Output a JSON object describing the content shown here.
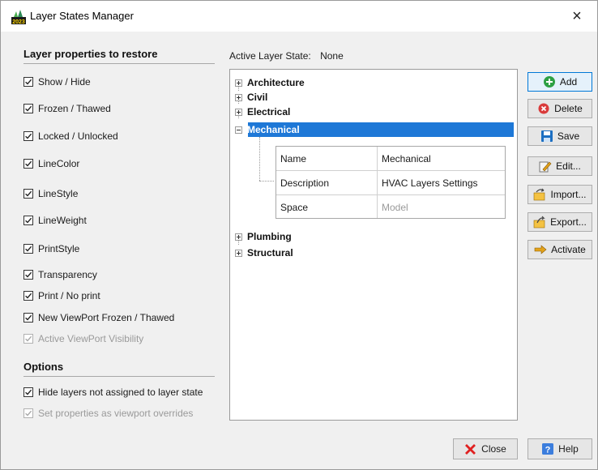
{
  "window": {
    "title": "Layer States Manager",
    "close_glyph": "×",
    "app_icon": "app-logo-icon"
  },
  "left": {
    "restore_title": "Layer properties to restore",
    "restore_items": [
      {
        "label": "Show / Hide",
        "checked": true,
        "enabled": true
      },
      {
        "label": "Frozen / Thawed",
        "checked": true,
        "enabled": true
      },
      {
        "label": "Locked / Unlocked",
        "checked": true,
        "enabled": true
      },
      {
        "label": "LineColor",
        "checked": true,
        "enabled": true
      },
      {
        "label": "LineStyle",
        "checked": true,
        "enabled": true
      },
      {
        "label": "LineWeight",
        "checked": true,
        "enabled": true
      },
      {
        "label": "PrintStyle",
        "checked": true,
        "enabled": true
      },
      {
        "label": "Transparency",
        "checked": true,
        "enabled": true
      },
      {
        "label": "Print / No print",
        "checked": true,
        "enabled": true
      },
      {
        "label": "New ViewPort Frozen / Thawed",
        "checked": true,
        "enabled": true
      },
      {
        "label": "Active ViewPort Visibility",
        "checked": true,
        "enabled": false
      }
    ],
    "options_title": "Options",
    "options_items": [
      {
        "label": "Hide layers not assigned to layer state",
        "checked": true,
        "enabled": true
      },
      {
        "label": "Set properties as viewport overrides",
        "checked": true,
        "enabled": false
      }
    ]
  },
  "active_state": {
    "label": "Active Layer State:",
    "value": "None"
  },
  "tree": {
    "nodes": [
      "Architecture",
      "Civil",
      "Electrical",
      "Mechanical",
      "Plumbing",
      "Structural"
    ],
    "selected": "Mechanical",
    "properties": [
      {
        "key": "Name",
        "value": "Mechanical",
        "dim": false
      },
      {
        "key": "Description",
        "value": "HVAC Layers Settings",
        "dim": false
      },
      {
        "key": "Space",
        "value": "Model",
        "dim": true
      }
    ]
  },
  "buttons": {
    "add": "Add",
    "delete": "Delete",
    "save": "Save",
    "edit": "Edit...",
    "import": "Import...",
    "export": "Export...",
    "activate": "Activate",
    "close": "Close",
    "help": "Help"
  },
  "colors": {
    "selection": "#1e78d7",
    "add_icon": "#2ea043",
    "delete_icon": "#d93b3b",
    "save_icon": "#1c6fc2",
    "close_icon": "#e02020",
    "help_icon": "#3b7ddd",
    "activate_icon": "#e3a21a"
  }
}
